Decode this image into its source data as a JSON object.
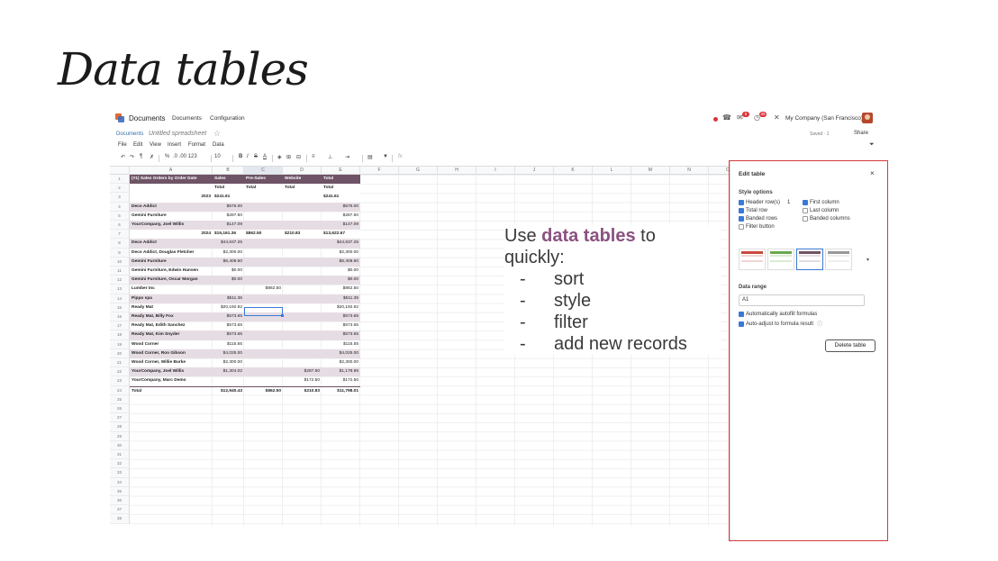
{
  "slide": {
    "title": "Data tables"
  },
  "nav": {
    "app_name": "Documents",
    "menu": [
      "Documents",
      "Configuration"
    ],
    "badge_msgs": "5",
    "badge_activity": "35",
    "company": "My Company (San Francisco)"
  },
  "breadcrumb": {
    "parent": "Documents",
    "current": "Untitled spreadsheet",
    "saved": "Saved · 1",
    "share": "Share"
  },
  "menubar": [
    "File",
    "Edit",
    "View",
    "Insert",
    "Format",
    "Data"
  ],
  "toolbar": {
    "format": ".0 .00 123",
    "font_size": "10"
  },
  "columns": [
    "A",
    "B",
    "C",
    "D",
    "E",
    "F",
    "G",
    "H",
    "I",
    "J",
    "K",
    "L",
    "M",
    "N",
    "O"
  ],
  "row_numbers": [
    "1",
    "2",
    "3",
    "4",
    "5",
    "6",
    "7",
    "8",
    "9",
    "10",
    "11",
    "12",
    "13",
    "14",
    "15",
    "16",
    "17",
    "18",
    "19",
    "20",
    "21",
    "22",
    "23",
    "24",
    "25",
    "26",
    "27",
    "28",
    "29",
    "30",
    "31",
    "32",
    "33",
    "34",
    "35",
    "36",
    "37",
    "38"
  ],
  "table": {
    "header": [
      "(#1) Sales Orders by Order Date",
      "Sales",
      "Pre-Sales",
      "Website",
      "Total"
    ],
    "subheader": [
      "",
      "Total",
      "Total",
      "Total",
      "Total"
    ],
    "rows": [
      [
        "2023",
        "$241.61",
        "",
        "",
        "$241.61"
      ],
      [
        "Deco Addict",
        "$575.00",
        "",
        "",
        "$575.00"
      ],
      [
        "Gemini Furniture",
        "$287.50",
        "",
        "",
        "$287.50"
      ],
      [
        "YourCompany, Joel Willis",
        "$147.09",
        "",
        "",
        "$147.09"
      ],
      [
        "2024",
        "$15,161.36",
        "$862.50",
        "$210.83",
        "$13,622.67"
      ],
      [
        "Deco Addict",
        "$44,637.25",
        "",
        "",
        "$44,637.25"
      ],
      [
        "Deco Addict, Douglas Fletcher",
        "$2,300.00",
        "",
        "",
        "$2,300.00"
      ],
      [
        "Gemini Furniture",
        "$6,408.60",
        "",
        "",
        "$6,408.60"
      ],
      [
        "Gemini Furniture, Edwin Hansen",
        "$0.00",
        "",
        "",
        "$0.00"
      ],
      [
        "Gemini Furniture, Oscar Morgan",
        "$0.00",
        "",
        "",
        "$0.00"
      ],
      [
        "Lumber Inc",
        "",
        "$862.50",
        "",
        "$862.50"
      ],
      [
        "Pippo spa",
        "$511.35",
        "",
        "",
        "$511.35"
      ],
      [
        "Ready Mat",
        "$20,192.92",
        "",
        "",
        "$20,192.92"
      ],
      [
        "Ready Mat, Billy Fox",
        "$573.65",
        "",
        "",
        "$573.65"
      ],
      [
        "Ready Mat, Edith Sanchez",
        "$573.65",
        "",
        "",
        "$573.65"
      ],
      [
        "Ready Mat, Kim Snyder",
        "$573.65",
        "",
        "",
        "$573.65"
      ],
      [
        "Wood Corner",
        "$115.55",
        "",
        "",
        "$115.55"
      ],
      [
        "Wood Corner, Ron Gibson",
        "$4,025.00",
        "",
        "",
        "$4,025.00"
      ],
      [
        "Wood Corner, Willie Burke",
        "$2,300.00",
        "",
        "",
        "$2,300.00"
      ],
      [
        "YourCompany, Joel Willis",
        "$1,304.02",
        "",
        "$287.50",
        "$1,178.95"
      ],
      [
        "YourCompany, Marc Demo",
        "",
        "",
        "$172.50",
        "$172.50"
      ]
    ],
    "total": [
      "Total",
      "$12,940.43",
      "$862.50",
      "$210.83",
      "$11,798.01"
    ]
  },
  "callout": {
    "intro_before": "Use ",
    "intro_highlight": "data tables",
    "intro_after": " to quickly:",
    "items": [
      "sort",
      "style",
      "filter",
      "add new records"
    ]
  },
  "panel": {
    "title": "Edit table",
    "style_options_label": "Style options",
    "header_rows_label": "Header row(s)",
    "header_rows_value": "1",
    "first_column": "First column",
    "total_row": "Total row",
    "last_column": "Last column",
    "banded_rows": "Banded rows",
    "banded_columns": "Banded columns",
    "filter_button": "Filter button",
    "data_range_label": "Data range",
    "data_range_value": "A1",
    "autofill": "Automatically autofill formulas",
    "autoadjust": "Auto-adjust to formula result",
    "delete_button": "Delete table",
    "checked": {
      "header_rows": true,
      "first_column": true,
      "total_row": true,
      "last_column": false,
      "banded_rows": true,
      "banded_columns": false,
      "filter_button": false,
      "autofill": true,
      "autoadjust": true
    }
  },
  "colors": {
    "table_header": "#6e5466",
    "band": "#e6dde4",
    "highlight": "#8a5180",
    "frame": "#d43a3a"
  }
}
